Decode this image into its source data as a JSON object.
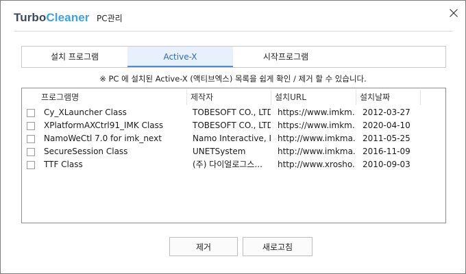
{
  "header": {
    "brand_part1": "Turbo",
    "brand_part2": "Cleaner",
    "subtitle": "PC관리",
    "close_icon": "close-icon"
  },
  "tabs": [
    {
      "label": "설치 프로그램",
      "active": false
    },
    {
      "label": "Active-X",
      "active": true
    },
    {
      "label": "시작프로그램",
      "active": false
    }
  ],
  "notice": "※ PC 에 설치된 Active-X (액티브엑스) 목록을 쉽게 확인 / 제거 할 수 있습니다.",
  "list": {
    "columns": [
      "프로그램명",
      "제작자",
      "설치URL",
      "설치날짜"
    ],
    "rows": [
      {
        "checked": false,
        "name": "Cy_XLauncher Class",
        "maker": "TOBESOFT CO., LTD.",
        "url": "https://www.imkm...",
        "date": "2012-03-27"
      },
      {
        "checked": false,
        "name": "XPlatformAXCtrl91_IMK Class",
        "maker": "TOBESOFT CO., LTD.",
        "url": "https://www.imkm...",
        "date": "2020-04-10"
      },
      {
        "checked": false,
        "name": "NamoWeCtl 7.0 for imk_next",
        "maker": "Namo Interactive, I...",
        "url": "http://www.imkma...",
        "date": "2011-05-25"
      },
      {
        "checked": false,
        "name": "SecureSession Class",
        "maker": "UNETSystem",
        "url": "http://www.imkma...",
        "date": "2016-11-09"
      },
      {
        "checked": false,
        "name": "TTF Class",
        "maker": "(주) 다이얼로그스...",
        "url": "http://www.xrosho...",
        "date": "2010-09-03"
      }
    ]
  },
  "buttons": {
    "remove": "제거",
    "refresh": "새로고침"
  },
  "colors": {
    "brand_dark": "#3d4a5e",
    "brand_accent": "#3ea1e6",
    "active_tab_bg": "#e8f1fb",
    "active_tab_text": "#2c6ab3"
  }
}
